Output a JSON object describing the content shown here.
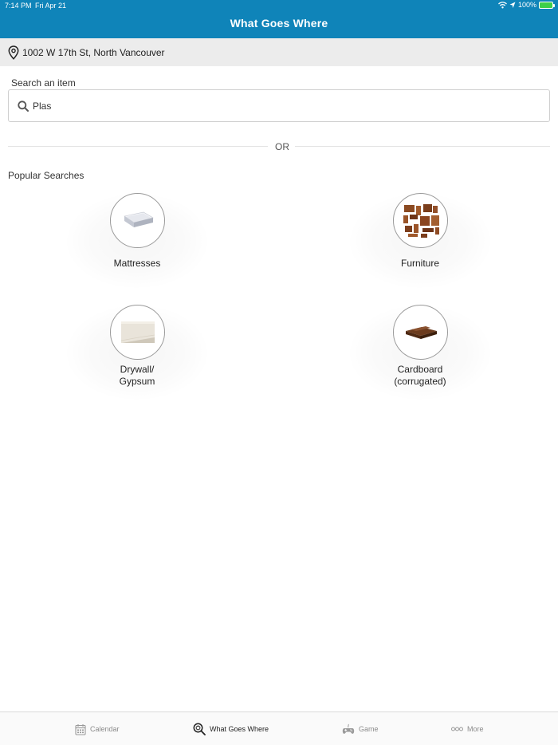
{
  "status_bar": {
    "time": "7:14 PM",
    "date": "Fri Apr 21",
    "battery": "100%"
  },
  "header": {
    "title": "What Goes Where"
  },
  "location": {
    "address": "1002 W 17th St, North Vancouver",
    "icon": "location-pin-icon"
  },
  "search": {
    "label": "Search an item",
    "value": "Plas",
    "placeholder": ""
  },
  "divider": {
    "or": "OR"
  },
  "popular": {
    "title": "Popular Searches",
    "items": [
      {
        "label": "Mattresses",
        "icon": "mattress-image"
      },
      {
        "label": "Furniture",
        "icon": "furniture-image"
      },
      {
        "label": "Drywall/\nGypsum",
        "label_line1": "Drywall/",
        "label_line2": "Gypsum",
        "icon": "drywall-image"
      },
      {
        "label_line1": "Cardboard",
        "label_line2": "(corrugated)",
        "icon": "cardboard-image"
      }
    ]
  },
  "tabs": [
    {
      "label": "Calendar",
      "icon": "calendar-icon",
      "active": false
    },
    {
      "label": "What Goes Where",
      "icon": "search-recycle-icon",
      "active": true
    },
    {
      "label": "Game",
      "icon": "gamepad-icon",
      "active": false
    },
    {
      "label": "More",
      "icon": "more-dots-icon",
      "active": false
    }
  ],
  "colors": {
    "accent": "#0f84b9",
    "address_bar_bg": "#ececec",
    "text": "#333333"
  }
}
